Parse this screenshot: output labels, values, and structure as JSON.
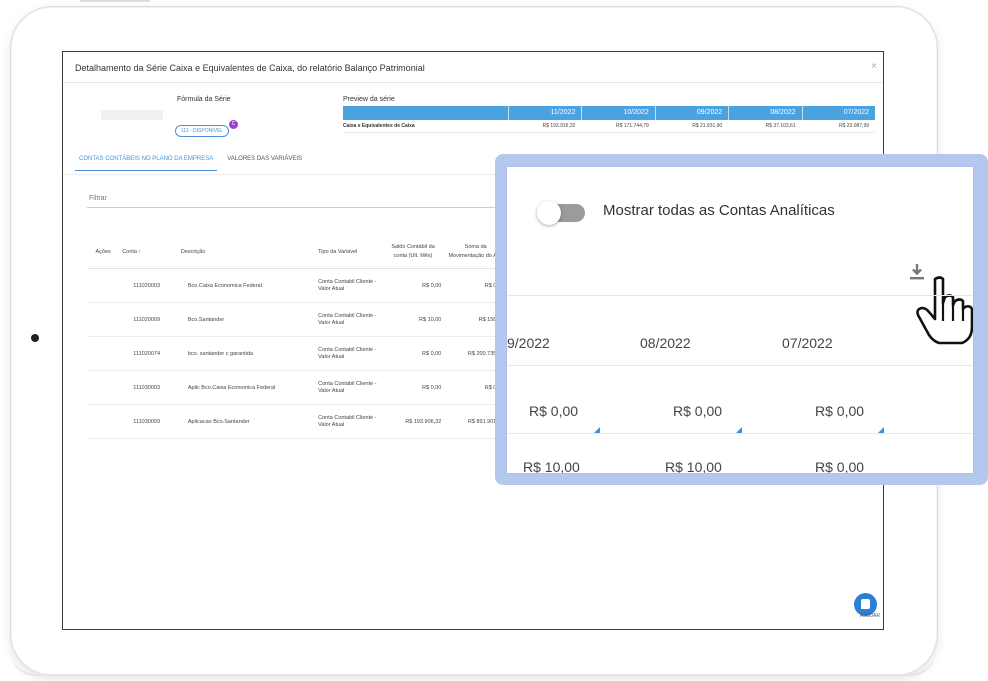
{
  "modal": {
    "title": "Detalhamento da Série Caixa e Equivalentes de Caixa, do relatório Balanço Patrimonial",
    "close_glyph": "×"
  },
  "formula": {
    "label": "Fórmula da Série",
    "chip": "111 - DISPONÍVEL",
    "badge": "C"
  },
  "preview": {
    "label": "Preview da série",
    "periods": [
      "11/2022",
      "10/2022",
      "09/2022",
      "08/2022",
      "07/2022"
    ],
    "row_label": "Caixa e Equivalentes de Caixa",
    "values": [
      "R$ 193.916,32",
      "R$ 171.744,79",
      "R$ 21.931,90",
      "R$ 37.103,61",
      "R$ 23.087,99"
    ]
  },
  "tabs": [
    {
      "label": "CONTAS CONTÁBEIS NO PLANO DA EMPRESA",
      "active": true
    },
    {
      "label": "VALORES DAS VARIÁVEIS",
      "active": false
    }
  ],
  "filter": {
    "label": "Filtrar"
  },
  "table": {
    "headers": {
      "acoes": "Ações",
      "conta": "Conta",
      "sort_glyph": "↑",
      "descricao": "Descrição",
      "tipo": "Tipo da Variável",
      "saldo": "Saldo Contábil da conta (Ult. Mês)",
      "soma": "Soma da Movimentação do Ano"
    },
    "rows": [
      {
        "conta": "111020003",
        "descricao": "Bco.Caixa Economica Federal",
        "tipo": "Conta Contabil Cliente - Valor Atual",
        "saldo": "R$ 0,00",
        "soma": "R$ 0,00"
      },
      {
        "conta": "111020009",
        "descricao": "Bco.Santander",
        "tipo": "Conta Contabil Cliente - Valor Atual",
        "saldo": "R$ 10,00",
        "soma": "R$ 158,05"
      },
      {
        "conta": "111020074",
        "descricao": "bco. santander c garantida",
        "tipo": "Conta Contabil Cliente - Valor Atual",
        "saldo": "R$ 0,00",
        "soma": "R$ 200.735,83"
      },
      {
        "conta": "111030003",
        "descricao": "Aplic Bco.Caixa Economica Federal",
        "tipo": "Conta Contabil Cliente - Valor Atual",
        "saldo": "R$ 0,00",
        "soma": "R$ 0,00"
      },
      {
        "conta": "111030009",
        "descricao": "Aplicacao Bco.Santander",
        "tipo": "Conta Contabil Cliente - Valor Atual",
        "saldo": "R$ 193.906,32",
        "soma": "R$ 891.901,65"
      }
    ]
  },
  "zoom": {
    "toggle_label": "Mostrar todas as Contas Analíticas",
    "toggle_on": false,
    "headers": [
      "9/2022",
      "08/2022",
      "07/2022"
    ],
    "rows": [
      [
        "R$ 0,00",
        "R$ 0,00",
        "R$ 0,00"
      ],
      [
        "R$ 10,00",
        "R$ 10,00",
        "R$ 0,00"
      ]
    ]
  },
  "chat": {
    "label": "AJUDAR"
  },
  "colors": {
    "accent": "#4a90d9",
    "header_blue": "#4aa3e0",
    "badge_purple": "#9b3cd6",
    "zoom_frame": "#b4c8ee",
    "chat_blue": "#2d7fd3"
  }
}
